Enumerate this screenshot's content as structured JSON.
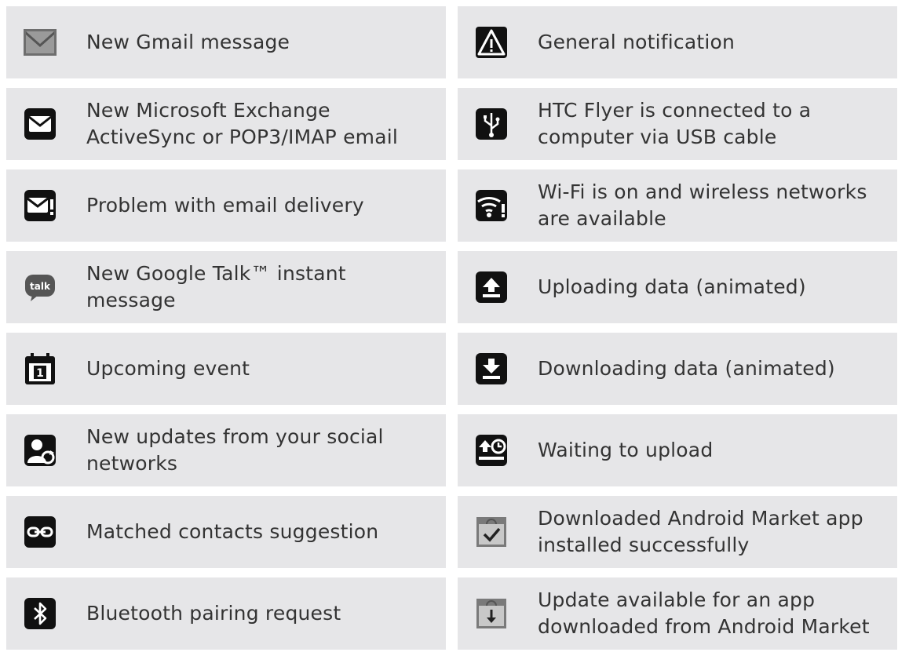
{
  "left": [
    {
      "icon": "gmail-icon",
      "text": "New Gmail message"
    },
    {
      "icon": "email-envelope-icon",
      "text": "New Microsoft Exchange\nActiveSync or POP3/IMAP email"
    },
    {
      "icon": "email-warning-icon",
      "text": "Problem with email delivery"
    },
    {
      "icon": "google-talk-icon",
      "icon_text": "talk",
      "text": "New Google Talk™ instant\nmessage"
    },
    {
      "icon": "calendar-icon",
      "icon_text": "1",
      "text": "Upcoming event"
    },
    {
      "icon": "social-update-icon",
      "text": "New updates from your social\nnetworks"
    },
    {
      "icon": "matched-contacts-icon",
      "text": "Matched contacts suggestion"
    },
    {
      "icon": "bluetooth-icon",
      "text": "Bluetooth pairing request"
    }
  ],
  "right": [
    {
      "icon": "warning-icon",
      "text": "General notification"
    },
    {
      "icon": "usb-icon",
      "text": "HTC Flyer is connected to a\ncomputer via USB cable"
    },
    {
      "icon": "wifi-available-icon",
      "text": "Wi-Fi is on and wireless networks\nare available"
    },
    {
      "icon": "upload-icon",
      "text": "Uploading data (animated)"
    },
    {
      "icon": "download-icon",
      "text": "Downloading data (animated)"
    },
    {
      "icon": "waiting-upload-icon",
      "text": "Waiting to upload"
    },
    {
      "icon": "market-installed-icon",
      "text": "Downloaded Android Market app\ninstalled successfully"
    },
    {
      "icon": "market-update-icon",
      "text": "Update available for an app\ndownloaded from Android Market"
    }
  ]
}
